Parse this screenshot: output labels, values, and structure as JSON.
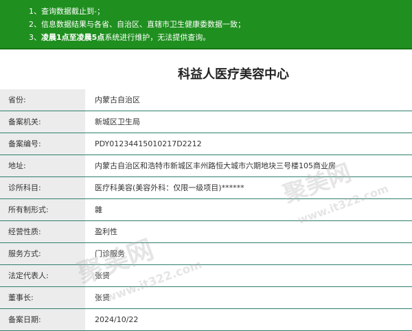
{
  "notice": {
    "line1": "1、查询数据截止到-；",
    "line2": "2、信息数据结果与各省、自治区、直辖市卫生健康委数据一致；",
    "line3_prefix": "3、",
    "line3_bold": "凌晨1点至凌晨5点",
    "line3_suffix": "系统进行维护，无法提供查询。"
  },
  "title": "科益人医疗美容中心",
  "rows": [
    {
      "label": "省份:",
      "value": "内蒙古自治区"
    },
    {
      "label": "备案机关:",
      "value": "新城区卫生局"
    },
    {
      "label": "备案编号:",
      "value": "PDY01234415010217D2212"
    },
    {
      "label": "地址:",
      "value": "内蒙古自治区和浩特市新城区丰州路恒大城市六期地块三号楼105商业房"
    },
    {
      "label": "诊所科目:",
      "value": "医疗科美容(美容外科：仅限一级项目)******"
    },
    {
      "label": "所有制形式:",
      "value": "雜"
    },
    {
      "label": "经营性质:",
      "value": "盈利性"
    },
    {
      "label": "服务方式:",
      "value": "门诊服务"
    },
    {
      "label": "法定代表人:",
      "value": "张贤"
    },
    {
      "label": "董事长:",
      "value": "张贤"
    },
    {
      "label": "备案日期:",
      "value": "2024/10/22"
    }
  ],
  "watermark": {
    "brand": "聚美网",
    "url": "www.it322.com"
  }
}
